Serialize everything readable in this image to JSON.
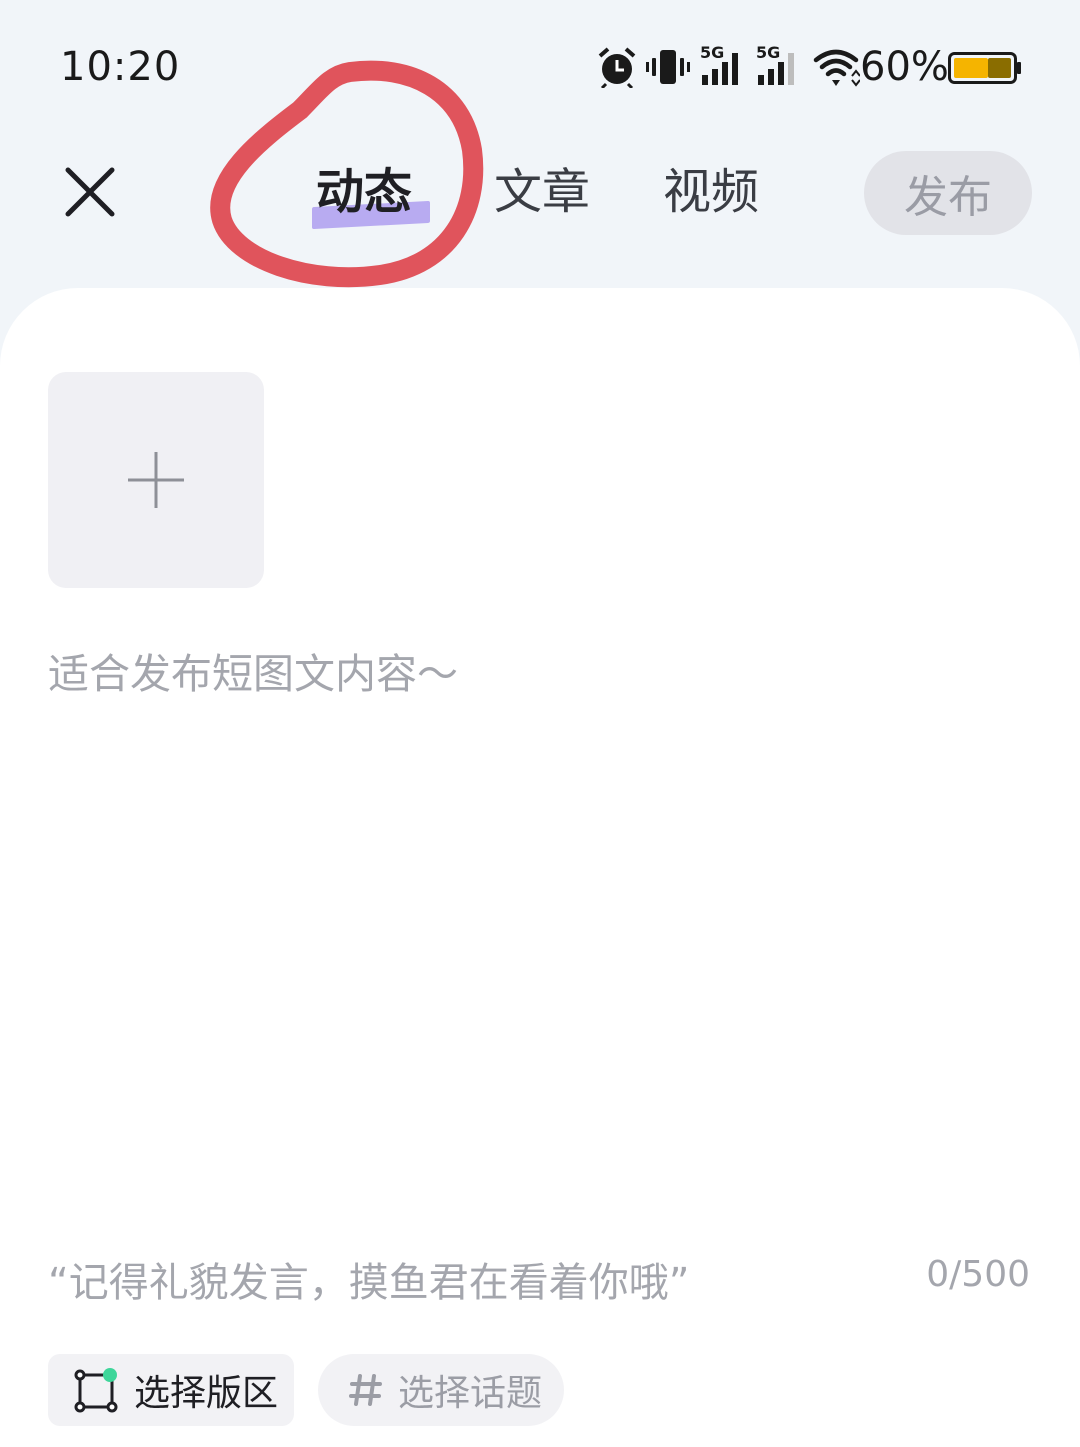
{
  "status_bar": {
    "time": "10:20",
    "network_1": "5G",
    "network_2": "5G",
    "battery_percent": "60%",
    "battery_level": 0.6
  },
  "nav": {
    "tabs": [
      {
        "label": "动态",
        "active": true
      },
      {
        "label": "文章",
        "active": false
      },
      {
        "label": "视频",
        "active": false
      }
    ],
    "publish_label": "发布"
  },
  "editor": {
    "placeholder": "适合发布短图文内容～",
    "hint": "“记得礼貌发言，摸鱼君在看着你哦”",
    "counter": "0/500"
  },
  "chips": {
    "board_label": "选择版区",
    "topic_label": "选择话题"
  },
  "colors": {
    "accent_underline": "#a492ee",
    "annotation_circle": "#e0545c",
    "card_background": "#ffffff",
    "page_background": "#f1f5f9"
  }
}
